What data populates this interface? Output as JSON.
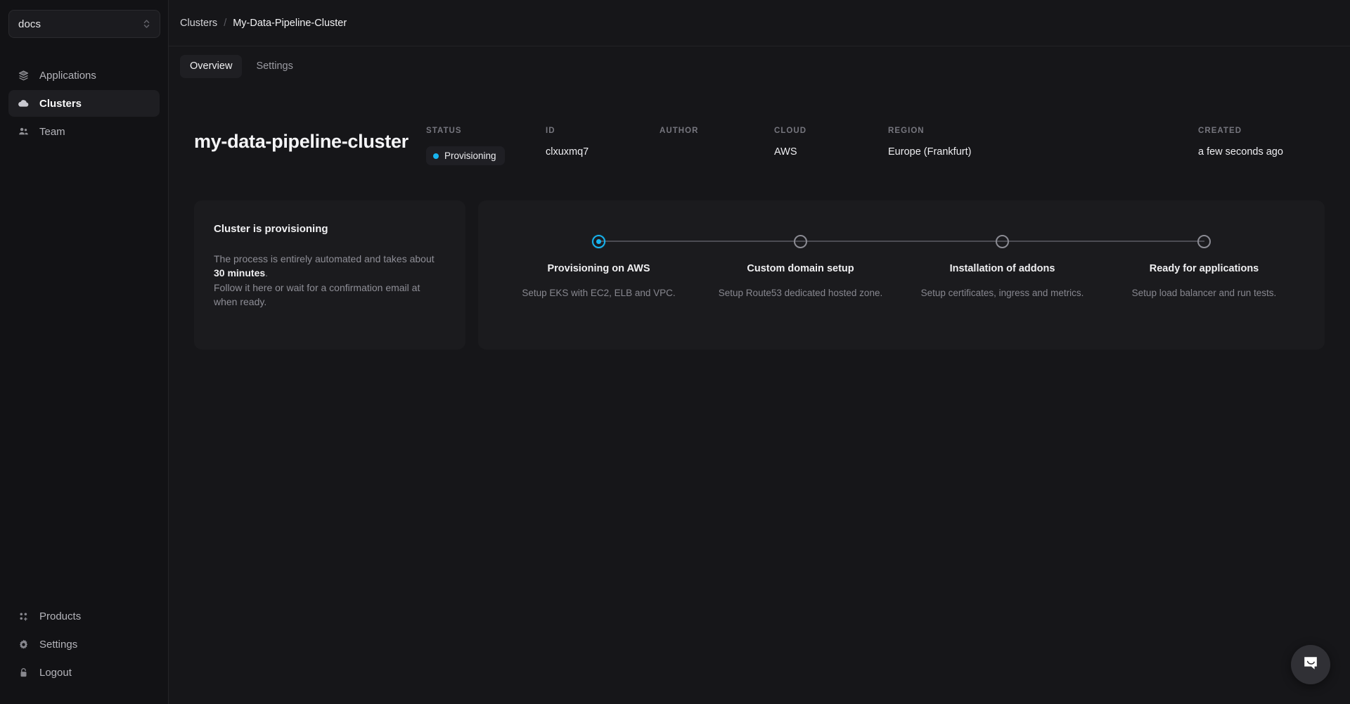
{
  "sidebar": {
    "workspace": {
      "name": "docs",
      "chevron_icon": "chevron-up-down-icon"
    },
    "items": [
      {
        "label": "Applications",
        "icon": "layers-icon",
        "active": false
      },
      {
        "label": "Clusters",
        "icon": "cloud-icon",
        "active": true
      },
      {
        "label": "Team",
        "icon": "users-icon",
        "active": false
      }
    ],
    "bottom_items": [
      {
        "label": "Products",
        "icon": "grid-plus-icon"
      },
      {
        "label": "Settings",
        "icon": "gear-icon"
      },
      {
        "label": "Logout",
        "icon": "lock-icon"
      }
    ]
  },
  "breadcrumb": {
    "root": "Clusters",
    "separator": "/",
    "leaf": "My-Data-Pipeline-Cluster"
  },
  "tabs": [
    {
      "label": "Overview",
      "active": true
    },
    {
      "label": "Settings",
      "active": false
    }
  ],
  "cluster": {
    "title": "my-data-pipeline-cluster",
    "meta": {
      "status_label": "STATUS",
      "status_value": "Provisioning",
      "status_dot_color": "#17b4ef",
      "id_label": "ID",
      "id_value": "clxuxmq7",
      "author_label": "AUTHOR",
      "author_value": "",
      "cloud_label": "CLOUD",
      "cloud_value": "AWS",
      "region_label": "REGION",
      "region_value": "Europe (Frankfurt)",
      "created_label": "CREATED",
      "created_value": "a few seconds ago"
    }
  },
  "info_card": {
    "heading": "Cluster is provisioning",
    "body_part1": "The process is entirely automated and takes about ",
    "body_strong": "30 minutes",
    "body_part2": ".",
    "body_line2": "Follow it here or wait for a confirmation email at",
    "body_line3": "when ready."
  },
  "steps": [
    {
      "title": "Provisioning on AWS",
      "desc": "Setup EKS with EC2, ELB and VPC.",
      "state": "active"
    },
    {
      "title": "Custom domain setup",
      "desc": "Setup Route53 dedicated hosted zone.",
      "state": "pending"
    },
    {
      "title": "Installation of addons",
      "desc": "Setup certificates, ingress and metrics.",
      "state": "pending"
    },
    {
      "title": "Ready for applications",
      "desc": "Setup load balancer and run tests.",
      "state": "pending"
    }
  ],
  "chat": {
    "icon": "chat-bubble-smile-icon"
  }
}
